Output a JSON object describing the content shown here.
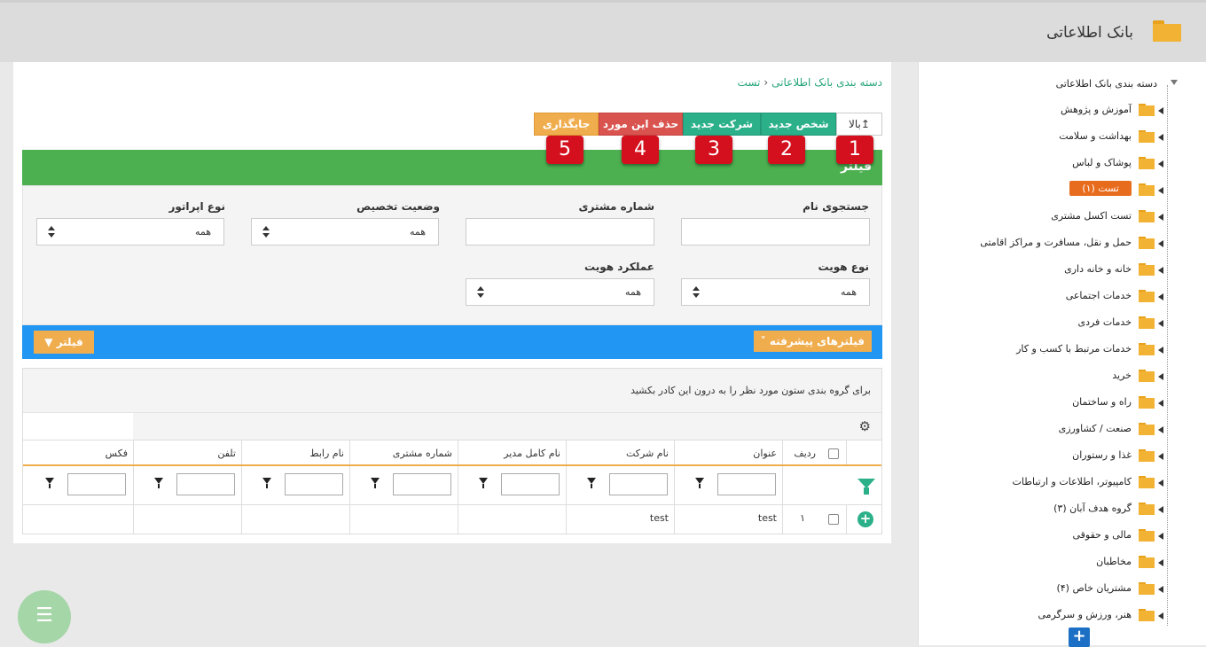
{
  "header": {
    "title": "بانک اطلاعاتی"
  },
  "breadcrumb": {
    "root": "دسته بندی بانک اطلاعاتی",
    "current": "تست"
  },
  "toolbar": {
    "up": "بالا",
    "new_person": "شخص جدید",
    "new_company": "شرکت جدید",
    "delete_item": "حذف این مورد",
    "placement": "جایگذاری"
  },
  "badges": [
    "1",
    "2",
    "3",
    "4",
    "5"
  ],
  "filter_panel": {
    "title": "فیلتر",
    "fields": {
      "name_search": {
        "label": "جستجوی نام",
        "value": ""
      },
      "customer_number": {
        "label": "شماره مشتری",
        "value": ""
      },
      "assignment_status": {
        "label": "وضعیت تخصیص",
        "value": "همه"
      },
      "operator_type": {
        "label": "نوع اپراتور",
        "value": "همه"
      },
      "identity_type": {
        "label": "نوع هویت",
        "value": "همه"
      },
      "identity_function": {
        "label": "عملکرد هویت",
        "value": "همه"
      }
    }
  },
  "actions": {
    "advanced_filters": "فیلترهای پیشرفته",
    "filter": "فیلتر"
  },
  "grid": {
    "group_hint": "برای گروه بندی ستون مورد نظر را به درون این کادر بکشید",
    "columns": [
      "ردیف",
      "عنوان",
      "نام شرکت",
      "نام کامل مدیر",
      "شماره مشتری",
      "نام رابط",
      "تلفن",
      "فکس"
    ],
    "rows": [
      {
        "row_no": "۱",
        "title": "test",
        "company": "test",
        "manager": "",
        "customer_no": "",
        "contact": "",
        "phone": "",
        "fax": ""
      }
    ]
  },
  "tree": {
    "root": "دسته بندی بانک اطلاعاتی",
    "items": [
      "آموزش و پژوهش",
      "بهداشت و سلامت",
      "پوشاک و لباس",
      "تست (۱)",
      "تست اکسل مشتری",
      "حمل و نقل، مسافرت و مراکز اقامتی",
      "خانه و خانه داری",
      "خدمات اجتماعی",
      "خدمات فردی",
      "خدمات مرتبط با کسب و کار",
      "خرید",
      "راه و ساختمان",
      "صنعت / کشاورزی",
      "غذا و رستوران",
      "کامپیوتر، اطلاعات و ارتباطات",
      "گروه هدف آبان (۳)",
      "مالی و حقوقی",
      "مخاطبان",
      "مشتریان خاص (۴)",
      "هنر، ورزش و سرگرمی"
    ],
    "active_index": 3
  },
  "icons": {
    "fab": "menu-icon",
    "tree_add": "plus-icon",
    "gear": "gear-icon",
    "folder": "folder-icon"
  },
  "colors": {
    "green_header": "#4caf50",
    "teal_button": "#2bb08a",
    "red_button": "#d9534f",
    "orange_button": "#f0ad4e",
    "blue_bar": "#2196f3",
    "active_tree": "#e86c1e",
    "badge_red": "#d4101e"
  }
}
